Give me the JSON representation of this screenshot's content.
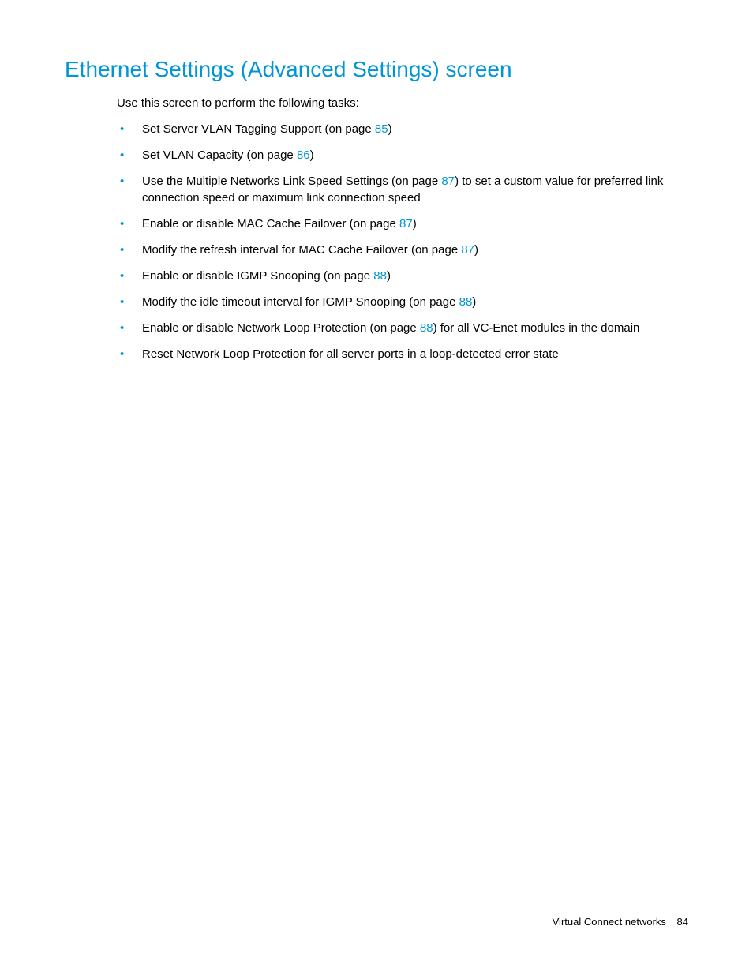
{
  "heading": "Ethernet Settings (Advanced Settings) screen",
  "intro": "Use this screen to perform the following tasks:",
  "bullets": [
    {
      "pre": "Set Server VLAN Tagging Support (on page ",
      "link": "85",
      "post": ")"
    },
    {
      "pre": "Set VLAN Capacity (on page ",
      "link": "86",
      "post": ")"
    },
    {
      "pre": "Use the Multiple Networks Link Speed Settings (on page ",
      "link": "87",
      "post": ") to set a custom value for preferred link connection speed or maximum link connection speed"
    },
    {
      "pre": "Enable or disable MAC Cache Failover (on page ",
      "link": "87",
      "post": ")"
    },
    {
      "pre": "Modify the refresh interval for MAC Cache Failover (on page ",
      "link": "87",
      "post": ")"
    },
    {
      "pre": "Enable or disable IGMP Snooping (on page ",
      "link": "88",
      "post": ")"
    },
    {
      "pre": "Modify the idle timeout interval for IGMP Snooping (on page ",
      "link": "88",
      "post": ")"
    },
    {
      "pre": "Enable or disable Network Loop Protection (on page ",
      "link": "88",
      "post": ") for all VC-Enet modules in the domain"
    },
    {
      "pre": "Reset Network Loop Protection for all server ports in a loop-detected error state",
      "link": "",
      "post": ""
    }
  ],
  "footer": {
    "section": "Virtual Connect networks",
    "page": "84"
  }
}
